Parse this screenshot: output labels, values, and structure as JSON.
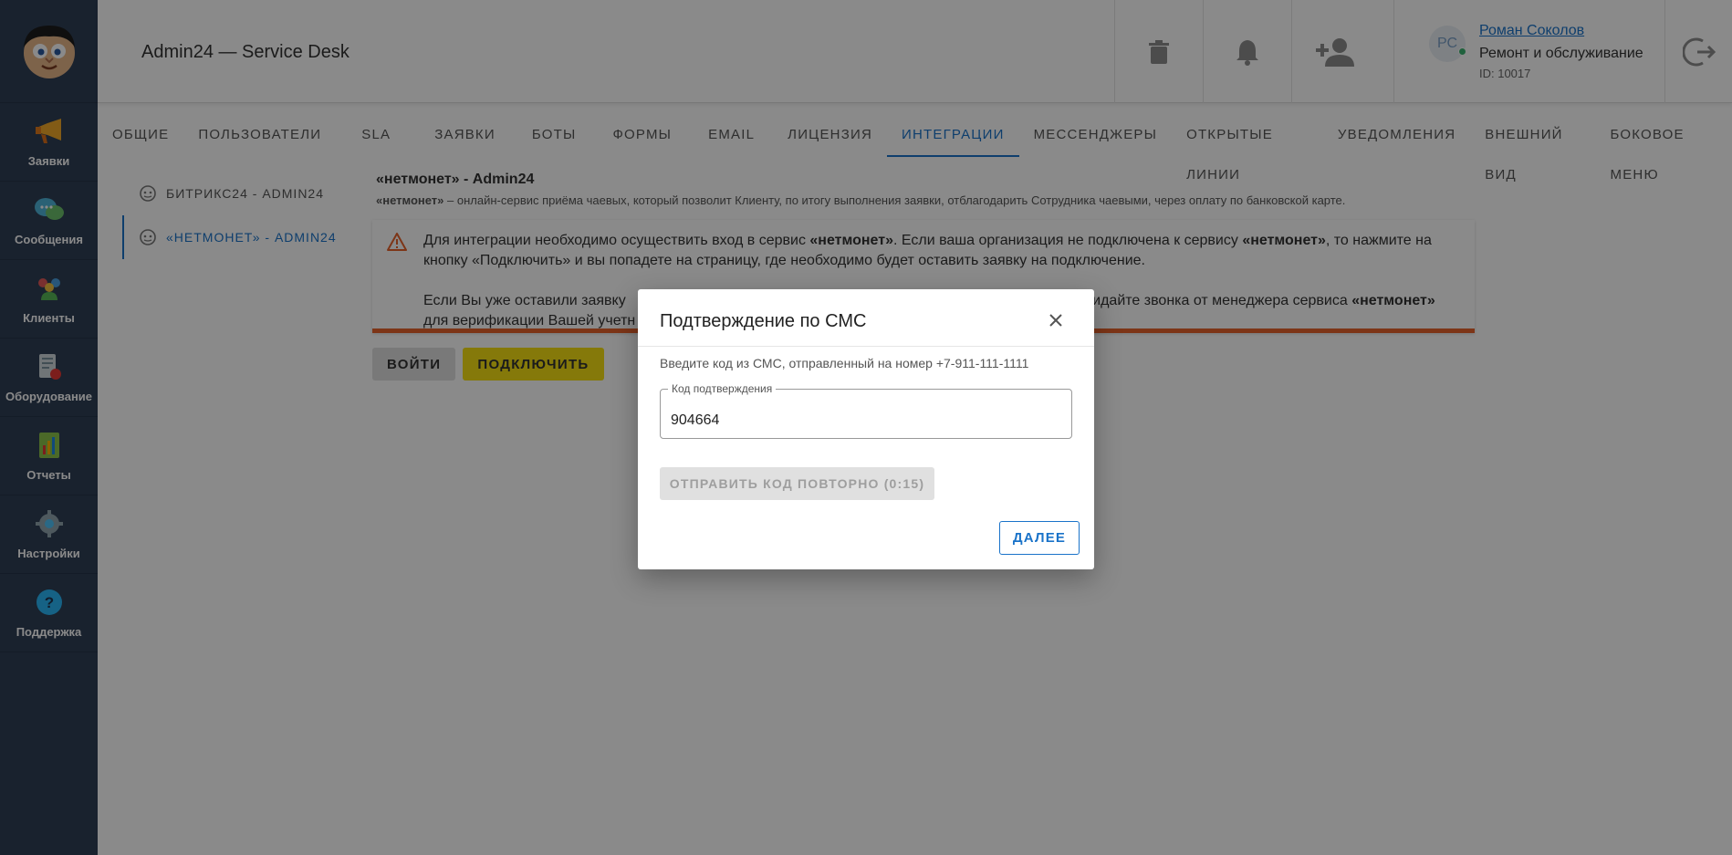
{
  "app": {
    "title": "Admin24 — Service Desk"
  },
  "sidebar": {
    "items": [
      {
        "label": "Заявки",
        "icon": "megaphone-icon"
      },
      {
        "label": "Сообщения",
        "icon": "chat-bubbles-icon"
      },
      {
        "label": "Клиенты",
        "icon": "users-icon"
      },
      {
        "label": "Оборудование",
        "icon": "equipment-icon"
      },
      {
        "label": "Отчеты",
        "icon": "report-icon"
      },
      {
        "label": "Настройки",
        "icon": "gear-icon"
      },
      {
        "label": "Поддержка",
        "icon": "help-icon"
      }
    ]
  },
  "header": {
    "user": {
      "initials": "РС",
      "name": "Роман Соколов",
      "department": "Ремонт и обслуживание",
      "id": "ID: 10017"
    }
  },
  "tabs": [
    {
      "label": "Общие"
    },
    {
      "label": "Пользователи"
    },
    {
      "label": "SLA"
    },
    {
      "label": "Заявки"
    },
    {
      "label": "Боты"
    },
    {
      "label": "Формы"
    },
    {
      "label": "Email"
    },
    {
      "label": "Лицензия"
    },
    {
      "label": "Интеграции",
      "active": true
    },
    {
      "label": "Мессенджеры"
    },
    {
      "label": "Открытые линии"
    },
    {
      "label": "Уведомления"
    },
    {
      "label": "Внешний вид"
    },
    {
      "label": "Боковое меню"
    }
  ],
  "subnav": [
    {
      "label": "БИТРИКС24 - ADMIN24"
    },
    {
      "label": "«НЕТМОНЕТ» - ADMIN24",
      "active": true
    }
  ],
  "content": {
    "title": "«нетмонет» - Admin24",
    "desc_brand": "«нетмонет»",
    "desc_rest": " – онлайн-сервис приёма чаевых, который позволит Клиенту, по итогу выполнения заявки, отблагодарить Сотрудника чаевыми, через оплату по банковской карте.",
    "alert": {
      "p1_a": "Для интеграции необходимо осуществить вход в сервис ",
      "brand": "«нетмонет»",
      "p1_b": ". Если ваша организация не подключена к сервису ",
      "p1_c": ", то нажмите на кнопку «Подключить» и вы попадете на страницу, где необходимо будет оставить заявку на подключение.",
      "p2_a": "Если Вы уже оставили заявку",
      "p2_b": "ожидайте звонка от менеджера сервиса ",
      "p2_c": "для верификации Вашей учетн"
    },
    "buttons": {
      "login": "ВОЙТИ",
      "connect": "ПОДКЛЮЧИТЬ"
    }
  },
  "dialog": {
    "title": "Подтверждение по СМС",
    "hint": "Введите код из СМС, отправленный на номер +7-911-111-1111",
    "field_label": "Код подтверждения",
    "field_value": "904664",
    "resend_label": "ОТПРАВИТЬ КОД ПОВТОРНО (0:15)",
    "next_label": "ДАЛЕЕ"
  },
  "colors": {
    "sidebar_bg": "#2f3f56",
    "accent": "#1a73c9",
    "connect_button": "#f5e013",
    "alert_border": "#e8632c"
  }
}
